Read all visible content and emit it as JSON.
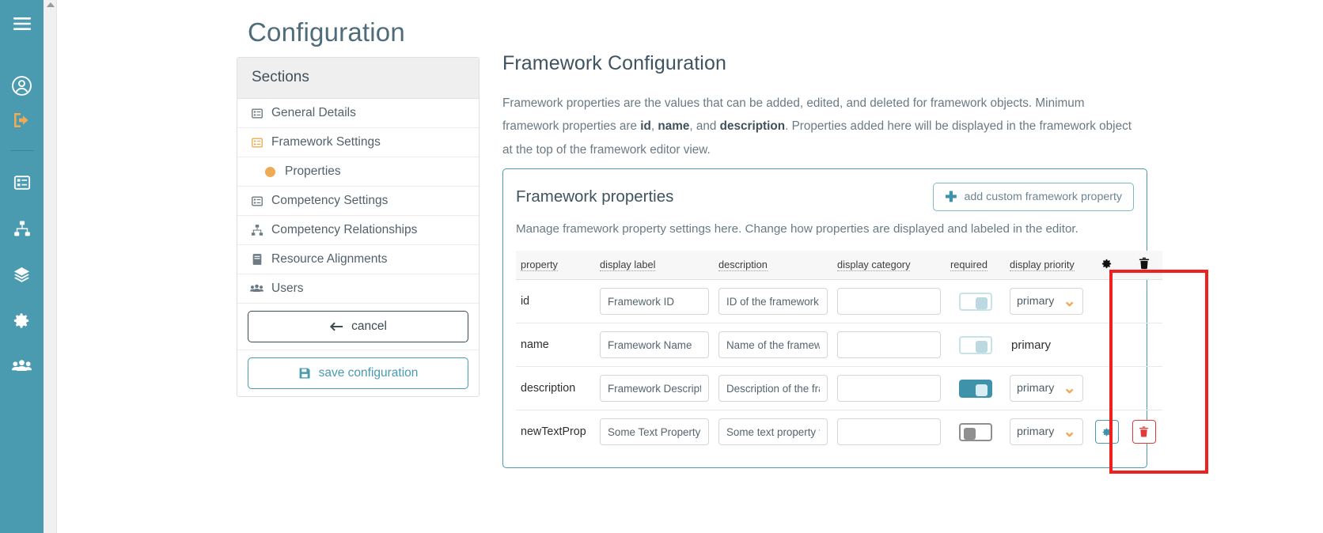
{
  "rail": {
    "icons": [
      {
        "name": "hamburger-menu-icon",
        "label": "menu"
      },
      {
        "name": "user-account-icon",
        "label": "account"
      },
      {
        "name": "logout-icon",
        "label": "logout"
      },
      {
        "name": "list-details-icon",
        "label": "general details"
      },
      {
        "name": "sitemap-icon",
        "label": "competency relationships"
      },
      {
        "name": "layers-icon",
        "label": "layers"
      },
      {
        "name": "gear-icon",
        "label": "settings"
      },
      {
        "name": "users-icon",
        "label": "users"
      }
    ]
  },
  "page": {
    "title": "Configuration"
  },
  "sections": {
    "header": "Sections",
    "items": [
      {
        "label": "General Details",
        "icon": "list-details-icon",
        "active": false,
        "sub": false
      },
      {
        "label": "Framework Settings",
        "icon": "list-details-icon",
        "active": true,
        "sub": false
      },
      {
        "label": "Properties",
        "icon": "dot-icon",
        "active": true,
        "sub": true
      },
      {
        "label": "Competency Settings",
        "icon": "list-details-icon",
        "active": false,
        "sub": false
      },
      {
        "label": "Competency Relationships",
        "icon": "sitemap-icon",
        "active": false,
        "sub": false
      },
      {
        "label": "Resource Alignments",
        "icon": "book-icon",
        "active": false,
        "sub": false
      },
      {
        "label": "Users",
        "icon": "users-icon",
        "active": false,
        "sub": false
      }
    ],
    "cancel_label": "cancel",
    "save_label": "save configuration"
  },
  "main": {
    "heading": "Framework Configuration",
    "intro_part1": "Framework properties are the values that can be added, edited, and deleted for framework objects. Minimum framework properties are ",
    "intro_b1": "id",
    "intro_sep1": ", ",
    "intro_b2": "name",
    "intro_sep2": ", and ",
    "intro_b3": "description",
    "intro_part2": ". Properties added here will be displayed in the framework object at the top of the framework editor view."
  },
  "props_card": {
    "title": "Framework properties",
    "add_button": "add custom framework property",
    "add_button_icon": "plus-icon",
    "subtitle": "Manage framework property settings here. Change how properties are displayed and labeled in the editor.",
    "columns": [
      {
        "key": "property",
        "label": "property"
      },
      {
        "key": "display_label",
        "label": "display label"
      },
      {
        "key": "description",
        "label": "description"
      },
      {
        "key": "display_category",
        "label": "display category"
      },
      {
        "key": "required",
        "label": "required"
      },
      {
        "key": "display_priority",
        "label": "display priority"
      },
      {
        "key": "settings",
        "label": "",
        "icon": "gear-icon"
      },
      {
        "key": "delete",
        "label": "",
        "icon": "trash-icon"
      }
    ],
    "rows": [
      {
        "property": "id",
        "display_label_value": "Framework ID",
        "description_value": "ID of the framework",
        "display_category_value": "",
        "required": false,
        "required_style": "off-light",
        "priority_kind": "select",
        "priority_value": "primary",
        "has_actions": false
      },
      {
        "property": "name",
        "display_label_value": "Framework Name",
        "description_value": "Name of the framework",
        "display_category_value": "",
        "required": false,
        "required_style": "off-light",
        "priority_kind": "text",
        "priority_value": "primary",
        "has_actions": false
      },
      {
        "property": "description",
        "display_label_value": "Framework Description",
        "description_value": "Description of the frame",
        "display_category_value": "",
        "required": true,
        "required_style": "on",
        "priority_kind": "select",
        "priority_value": "primary",
        "has_actions": false
      },
      {
        "property": "newTextProp",
        "display_label_value": "Some Text Property",
        "description_value": "Some text property for t",
        "display_category_value": "",
        "required": false,
        "required_style": "off-gray",
        "priority_kind": "select",
        "priority_value": "primary",
        "has_actions": true
      }
    ]
  },
  "highlight": {
    "color": "#ef2020",
    "name": "actions-column-highlight"
  },
  "colors": {
    "rail_bg": "#4a9bb0",
    "accent_teal": "#3e93ab",
    "accent_orange": "#eeab56",
    "danger_red": "#e03b3b",
    "highlight_red": "#ef2020"
  }
}
